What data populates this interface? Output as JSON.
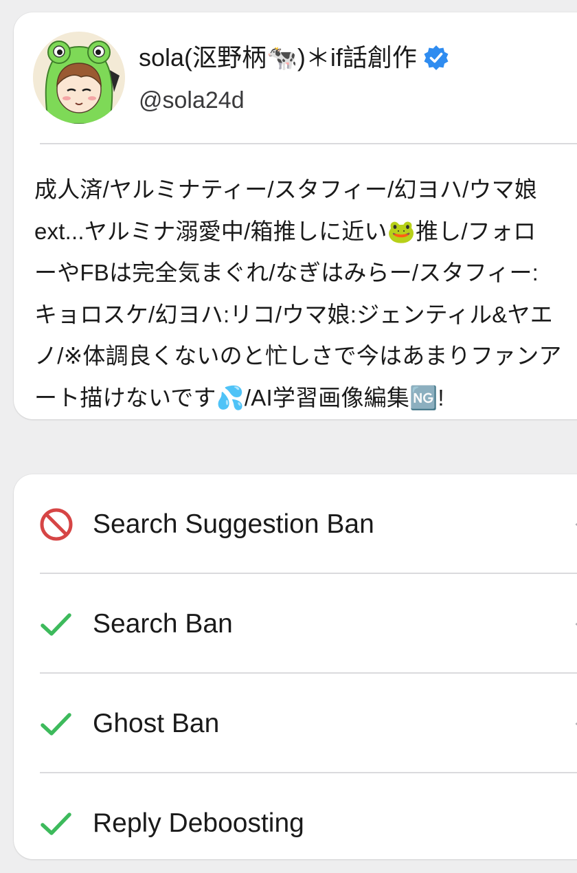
{
  "profile": {
    "display_name": "sola(沤野柄🐄)＊if話創作",
    "handle": "@sola24d",
    "avatar": "frog-hood-avatar",
    "verified_icon": "verified-badge-icon",
    "bio_lines": [
      "成人済/ヤルミナティー/スタフィー/幻ヨハ/ウマ娘",
      "ext...ヤルミナ溺愛中/箱推しに近い🐸推し/フォロ",
      "ーやFBは完全気まぐれ/なぎはみらー/スタフィー:",
      "キョロスケ/幻ヨハ:リコ/ウマ娘:ジェンティル&ヤエ",
      "ノ/※体調良くないのと忙しさで今はあまりファンア",
      "ート描けないです💦/AI学習画像編集🆖!"
    ]
  },
  "checks": [
    {
      "label": "Search Suggestion Ban",
      "status": "banned",
      "icon": "prohibited-icon"
    },
    {
      "label": "Search Ban",
      "status": "ok",
      "icon": "checkmark-icon"
    },
    {
      "label": "Ghost Ban",
      "status": "ok",
      "icon": "checkmark-icon"
    },
    {
      "label": "Reply Deboosting",
      "status": "ok",
      "icon": "checkmark-icon"
    }
  ],
  "colors": {
    "background": "#eeeeef",
    "card": "#ffffff",
    "banned": "#d64545",
    "ok": "#3dba5c",
    "verified": "#2f8cf0"
  }
}
